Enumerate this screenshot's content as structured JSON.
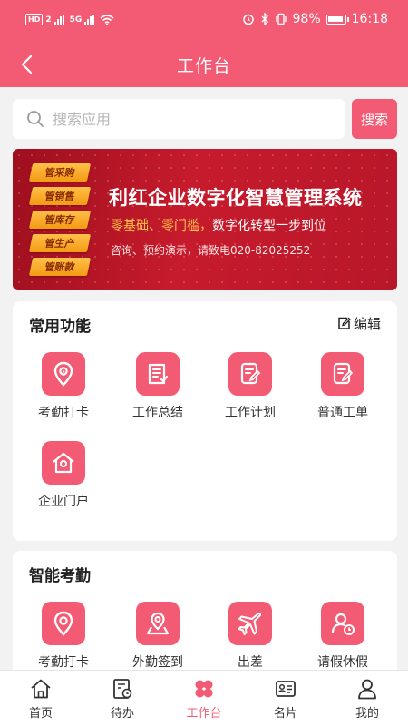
{
  "status_bar": {
    "left_badge": "HD",
    "sim_number": "2",
    "network": "5G",
    "battery": "98%",
    "time": "16:18"
  },
  "header": {
    "title": "工作台"
  },
  "search": {
    "placeholder": "搜索应用",
    "button_label": "搜索"
  },
  "banner": {
    "tags": [
      "管采购",
      "管销售",
      "管库存",
      "管生产",
      "管账款"
    ],
    "title": "利红企业数字化智慧管理系统",
    "slogan_highlight": "零基础、零门槛，",
    "slogan_rest": "数字化转型一步到位",
    "contact": "咨询、预约演示，请致电020-82025252"
  },
  "common_functions": {
    "title": "常用功能",
    "edit_label": "编辑",
    "items": [
      {
        "label": "考勤打卡",
        "icon": "location-pin-icon"
      },
      {
        "label": "工作总结",
        "icon": "summary-doc-icon"
      },
      {
        "label": "工作计划",
        "icon": "plan-edit-icon"
      },
      {
        "label": "普通工单",
        "icon": "work-order-icon"
      },
      {
        "label": "企业门户",
        "icon": "home-icon"
      }
    ]
  },
  "smart_attendance": {
    "title": "智能考勤",
    "items": [
      {
        "label": "考勤打卡",
        "icon": "location-pin-icon"
      },
      {
        "label": "外勤签到",
        "icon": "map-pin-icon"
      },
      {
        "label": "出差",
        "icon": "airplane-icon"
      },
      {
        "label": "请假休假",
        "icon": "leave-icon"
      }
    ]
  },
  "tabbar": {
    "active": "工作台",
    "items": [
      {
        "label": "首页",
        "icon": "home-outline-icon"
      },
      {
        "label": "待办",
        "icon": "todo-icon"
      },
      {
        "label": "工作台",
        "icon": "workbench-icon"
      },
      {
        "label": "名片",
        "icon": "business-card-icon"
      },
      {
        "label": "我的",
        "icon": "user-icon"
      }
    ]
  },
  "colors": {
    "primary": "#f35a73",
    "background": "#f2f2f2",
    "banner": "#c61b2c",
    "highlight": "#ffc24a"
  }
}
